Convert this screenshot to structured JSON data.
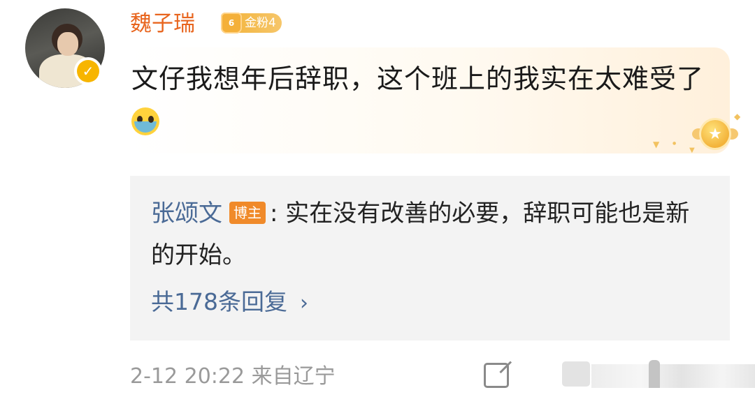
{
  "user": {
    "name": "魏子瑞",
    "fan_badge_level": "6",
    "fan_badge_label": "金粉4",
    "verified_mark": "✓"
  },
  "comment": {
    "text": "文仔我想年后辞职，这个班上的我实在太难受了"
  },
  "reply": {
    "author": "张颂文",
    "author_badge": "博主",
    "text": ": 实在没有改善的必要，辞职可能也是新的开始。",
    "total_replies": "共178条回复",
    "chevron": "›"
  },
  "footer": {
    "timestamp": "2-12 20:22 来自辽宁"
  },
  "icons": {
    "avatar": "avatar-photo",
    "verified": "verified-badge-icon",
    "crown": "crown-badge-icon",
    "emoji": "crying-face-emoji",
    "star": "star-medal-icon",
    "share": "share-icon",
    "comment": "comment-icon",
    "like": "like-icon"
  },
  "colors": {
    "username": "#e8651e",
    "reply_name": "#4a6a96",
    "badge_orange": "#f08a2a",
    "gold": "#f3b744"
  }
}
